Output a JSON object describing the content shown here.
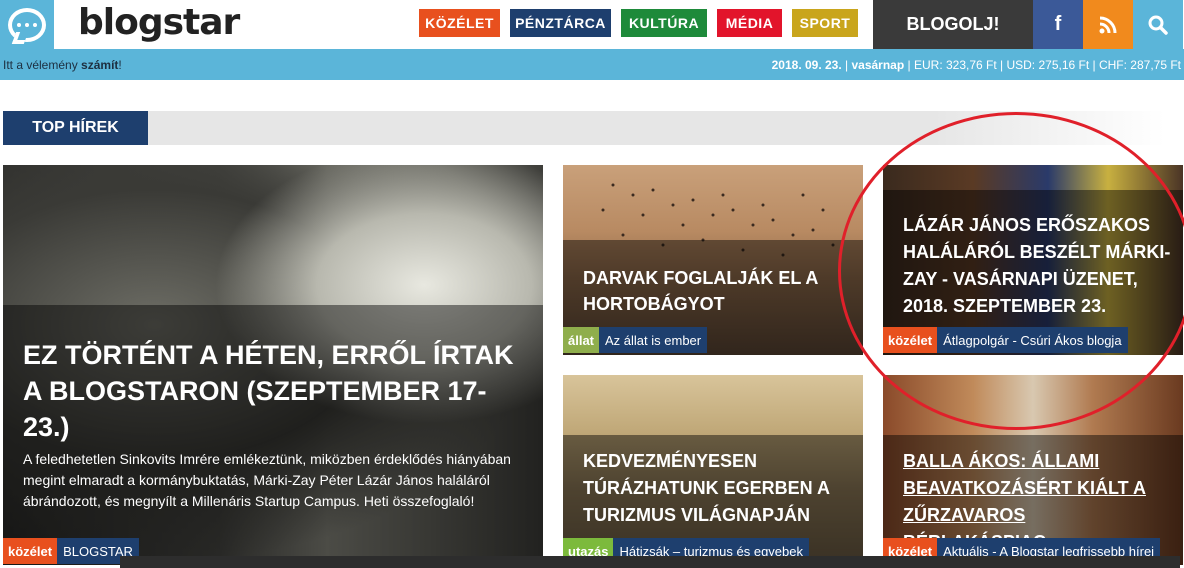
{
  "header": {
    "logo_text": "blogstar",
    "nav": [
      {
        "label": "KÖZÉLET",
        "color": "#e8501e"
      },
      {
        "label": "PÉNZTÁRCA",
        "color": "#1e3f6e"
      },
      {
        "label": "KULTÚRA",
        "color": "#1e8a3a"
      },
      {
        "label": "MÉDIA",
        "color": "#e2142b"
      },
      {
        "label": "SPORT",
        "color": "#c9a51c"
      }
    ],
    "cta": "BLOGOLJ!",
    "icons": {
      "facebook": "f",
      "rss": "rss-icon",
      "search": "search-icon"
    }
  },
  "infobar": {
    "slogan_prefix": "Itt a vélemény ",
    "slogan_bold": "számít",
    "slogan_suffix": "!",
    "date": "2018. 09. 23.",
    "day": "vasárnap",
    "rates": "| EUR: 323,76 Ft | USD: 275,16 Ft | CHF: 287,75 Ft"
  },
  "section": {
    "title": "TOP HÍREK"
  },
  "articles": {
    "main": {
      "title": "EZ TÖRTÉNT A HÉTEN, ERRŐL ÍRTAK A BLOGSTARON (SZEPTEMBER 17-23.)",
      "lead": "A feledhetetlen Sinkovits Imrére emlékeztünk, miközben érdeklődés hiányában megint elmaradt a kormánybuktatás, Márki-Zay Péter Lázár János haláláról ábrándozott, és megnyílt a Millenáris Startup Campus. Heti összefoglaló!",
      "category": "közélet",
      "blog": "BLOGSTAR"
    },
    "cranes": {
      "title": "DARVAK FOGLALJÁK EL A HORTOBÁGYOT",
      "category": "állat",
      "blog": "Az állat is ember"
    },
    "lazar": {
      "title": "LÁZÁR JÁNOS ERŐSZAKOS HALÁLÁRÓL BESZÉLT MÁRKI-ZAY - VASÁRNAPI ÜZENET, 2018. SZEPTEMBER 23.",
      "category": "közélet",
      "blog": "Átlagpolgár - Csúri Ákos blogja"
    },
    "eger": {
      "title": "KEDVEZMÉNYESEN TÚRÁZHATUNK EGERBEN A TURIZMUS VILÁGNAPJÁN",
      "category": "utazás",
      "blog": "Hátizsák – turizmus és egyebek"
    },
    "balla": {
      "title": "BALLA ÁKOS: ÁLLAMI BEAVATKOZÁSÉRT KIÁLT A ZŰRZAVAROS BÉRLAKÁSPIAC",
      "category": "közélet",
      "blog": "Aktuális - A Blogstar legfrissebb hírei"
    }
  },
  "colors": {
    "brand_blue": "#5bb5d9",
    "navy": "#1e3f6e",
    "kozelet": "#e8501e",
    "allat": "#8fae4c",
    "utazas": "#7cba3c",
    "highlight_circle": "#e0202a"
  }
}
